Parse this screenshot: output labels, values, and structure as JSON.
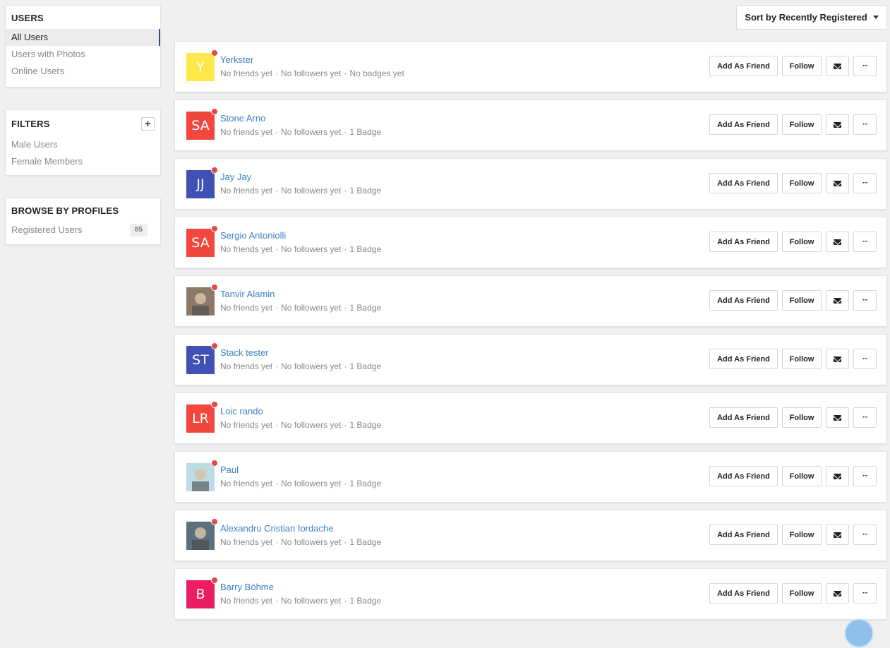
{
  "sidebar": {
    "users": {
      "title": "USERS",
      "items": [
        {
          "label": "All Users"
        },
        {
          "label": "Users with Photos"
        },
        {
          "label": "Online Users"
        }
      ]
    },
    "filters": {
      "title": "FILTERS",
      "add_label": "+",
      "items": [
        {
          "label": "Male Users"
        },
        {
          "label": "Female Members"
        }
      ]
    },
    "browse": {
      "title": "BROWSE BY PROFILES",
      "items": [
        {
          "label": "Registered Users",
          "count": "85"
        }
      ]
    }
  },
  "sort": {
    "label": "Sort by Recently Registered"
  },
  "actions": {
    "add_friend": "Add As Friend",
    "follow": "Follow",
    "message_icon": "envelope-icon",
    "more_label": "···"
  },
  "colors": {
    "link": "#3d7fc1",
    "status_offline": "#e04a4a",
    "active_border": "#3b4a9b"
  },
  "users": [
    {
      "name": "Yerkster",
      "initials": "Y",
      "avatar_color": "#fde84b",
      "photo": false,
      "friends": "No friends yet",
      "followers": "No followers yet",
      "badges": "No badges yet"
    },
    {
      "name": "Stone Arno",
      "initials": "SA",
      "avatar_color": "#f2473f",
      "photo": false,
      "friends": "No friends yet",
      "followers": "No followers yet",
      "badges": "1 Badge"
    },
    {
      "name": "Jay Jay",
      "initials": "JJ",
      "avatar_color": "#3f51b5",
      "photo": false,
      "friends": "No friends yet",
      "followers": "No followers yet",
      "badges": "1 Badge"
    },
    {
      "name": "Sergio Antoniolli",
      "initials": "SA",
      "avatar_color": "#f2473f",
      "photo": false,
      "friends": "No friends yet",
      "followers": "No followers yet",
      "badges": "1 Badge"
    },
    {
      "name": "Tanvir Alamin",
      "initials": "",
      "avatar_color": "#8a7a6a",
      "photo": true,
      "friends": "No friends yet",
      "followers": "No followers yet",
      "badges": "1 Badge"
    },
    {
      "name": "Stack tester",
      "initials": "ST",
      "avatar_color": "#3f51b5",
      "photo": false,
      "friends": "No friends yet",
      "followers": "No followers yet",
      "badges": "1 Badge"
    },
    {
      "name": "Loic rando",
      "initials": "LR",
      "avatar_color": "#f2473f",
      "photo": false,
      "friends": "No friends yet",
      "followers": "No followers yet",
      "badges": "1 Badge"
    },
    {
      "name": "Paul",
      "initials": "",
      "avatar_color": "#b9dde3",
      "photo": true,
      "friends": "No friends yet",
      "followers": "No followers yet",
      "badges": "1 Badge"
    },
    {
      "name": "Alexandru Cristian Iordache",
      "initials": "",
      "avatar_color": "#5c6f7c",
      "photo": true,
      "friends": "No friends yet",
      "followers": "No followers yet",
      "badges": "1 Badge"
    },
    {
      "name": "Barry Böhme",
      "initials": "B",
      "avatar_color": "#e91e63",
      "photo": false,
      "friends": "No friends yet",
      "followers": "No followers yet",
      "badges": "1 Badge"
    }
  ]
}
